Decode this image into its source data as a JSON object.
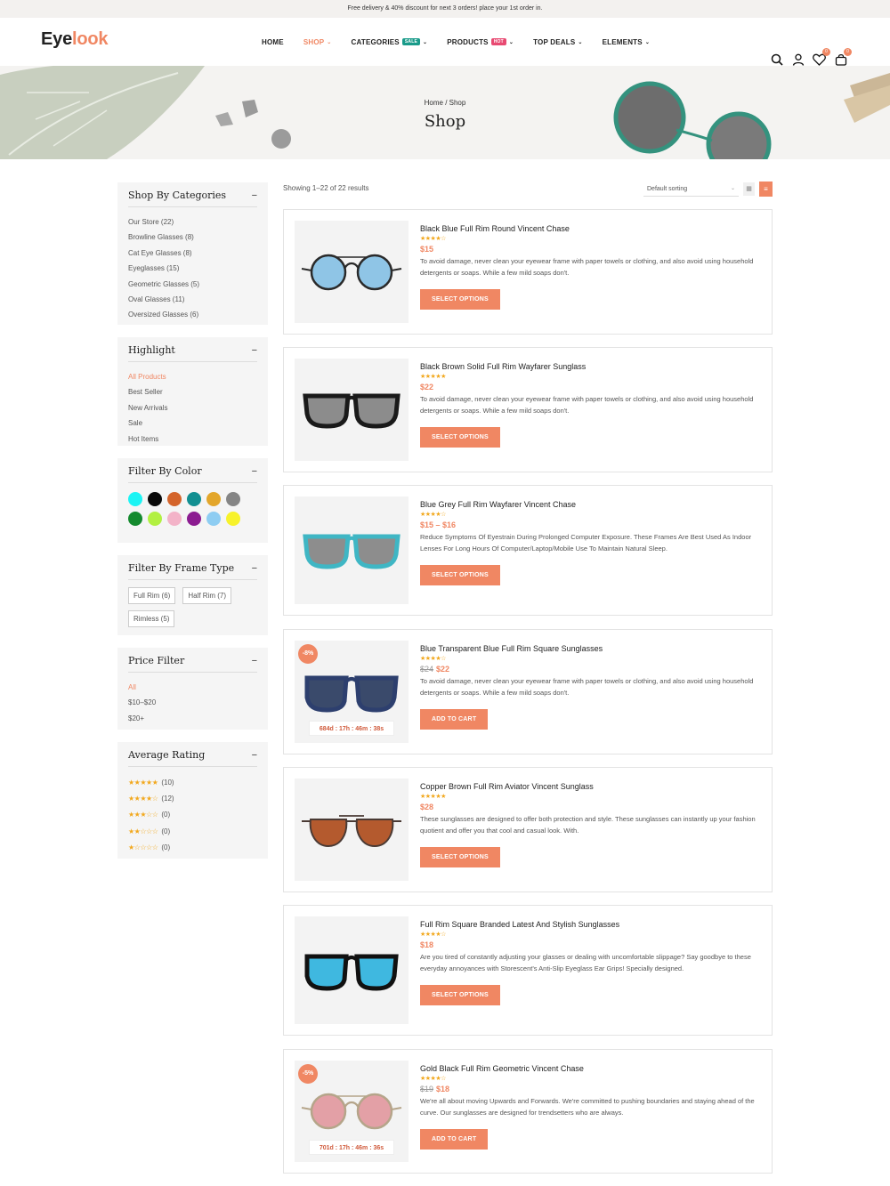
{
  "topbar": {
    "text": "Free delivery & 40% discount for next 3 orders! place your 1st order in."
  },
  "logo": {
    "part1": "Eye",
    "part2": "look"
  },
  "nav": [
    {
      "label": "HOME",
      "active": false,
      "dropdown": false,
      "tag": ""
    },
    {
      "label": "SHOP",
      "active": true,
      "dropdown": true,
      "tag": ""
    },
    {
      "label": "CATEGORIES",
      "active": false,
      "dropdown": true,
      "tag": "SALE"
    },
    {
      "label": "PRODUCTS",
      "active": false,
      "dropdown": true,
      "tag": "HOT"
    },
    {
      "label": "TOP DEALS",
      "active": false,
      "dropdown": true,
      "tag": ""
    },
    {
      "label": "ELEMENTS",
      "active": false,
      "dropdown": true,
      "tag": ""
    }
  ],
  "header_icons": {
    "wishlist_count": "0",
    "cart_count": "0"
  },
  "banner": {
    "breadcrumb": "Home / Shop",
    "title": "Shop"
  },
  "sidebar": {
    "categories": {
      "title": "Shop By Categories",
      "items": [
        "Our Store (22)",
        "Browline Glasses (8)",
        "Cat Eye Glasses (8)",
        "Eyeglasses (15)",
        "Geometric Glasses (5)",
        "Oval Glasses (11)",
        "Oversized Glasses (6)"
      ]
    },
    "highlight": {
      "title": "Highlight",
      "items": [
        "All Products",
        "Best Seller",
        "New Arrivals",
        "Sale",
        "Hot Items"
      ],
      "active_index": 0
    },
    "colors": {
      "title": "Filter By Color",
      "swatches": [
        "#1cf4f4",
        "#0a0a0a",
        "#d4642b",
        "#128f91",
        "#e3a62b",
        "#858585",
        "#148a2e",
        "#b2f041",
        "#f3b3c8",
        "#8c1c91",
        "#8ecdf2",
        "#f7f22b"
      ]
    },
    "frame_type": {
      "title": "Filter By Frame Type",
      "items": [
        "Full Rim (6)",
        "Half Rim (7)",
        "Rimless (5)"
      ]
    },
    "price": {
      "title": "Price Filter",
      "items": [
        "All",
        "$10–$20",
        "$20+"
      ],
      "active_index": 0
    },
    "rating": {
      "title": "Average Rating",
      "rows": [
        {
          "stars": 5,
          "count": "(10)"
        },
        {
          "stars": 4,
          "count": "(12)"
        },
        {
          "stars": 3,
          "count": "(0)"
        },
        {
          "stars": 2,
          "count": "(0)"
        },
        {
          "stars": 1,
          "count": "(0)"
        }
      ]
    }
  },
  "toolbar": {
    "results": "Showing 1–22 of 22 results",
    "sorting": "Default sorting"
  },
  "products": [
    {
      "name": "Black Blue Full Rim Round Vincent Chase",
      "stars": 4,
      "old_price": "",
      "price": "$15",
      "desc": "To avoid damage, never clean your eyewear frame with paper towels or clothing, and also avoid using household detergents or soaps. While a few mild soaps don't.",
      "button": "SELECT OPTIONS",
      "discount": "",
      "timer": "",
      "frame": "round",
      "lens": "#8fc5e6",
      "rim": "#2a2a2a"
    },
    {
      "name": "Black Brown Solid Full Rim Wayfarer Sunglass",
      "stars": 5,
      "old_price": "",
      "price": "$22",
      "desc": "To avoid damage, never clean your eyewear frame with paper towels or clothing, and also avoid using household detergents or soaps. While a few mild soaps don't.",
      "button": "SELECT OPTIONS",
      "discount": "",
      "timer": "",
      "frame": "wayfarer",
      "lens": "#8c8c8c",
      "rim": "#1a1a1a"
    },
    {
      "name": "Blue Grey Full Rim Wayfarer Vincent Chase",
      "stars": 4,
      "old_price": "",
      "price": "$15 – $16",
      "desc": "Reduce Symptoms Of Eyestrain During Prolonged Computer Exposure. These Frames Are Best Used As Indoor Lenses For Long Hours Of Computer/Laptop/Mobile Use To Maintain Natural Sleep.",
      "button": "SELECT OPTIONS",
      "discount": "",
      "timer": "",
      "frame": "wayfarer",
      "lens": "#8d8d8d",
      "rim": "#3fb6c4"
    },
    {
      "name": "Blue Transparent Blue Full Rim Square Sunglasses",
      "stars": 4,
      "old_price": "$24",
      "price": "$22",
      "desc": "To avoid damage, never clean your eyewear frame with paper towels or clothing, and also avoid using household detergents or soaps. While a few mild soaps don't.",
      "button": "ADD TO CART",
      "discount": "-8%",
      "timer": "684d : 17h : 46m : 38s",
      "frame": "square",
      "lens": "#3a4a6b",
      "rim": "#2d3f6e"
    },
    {
      "name": "Copper Brown Full Rim Aviator Vincent Sunglass",
      "stars": 5,
      "old_price": "",
      "price": "$28",
      "desc": "These sunglasses are designed to offer both protection and style. These sunglasses can instantly up your fashion quotient and offer you that cool and casual look. With.",
      "button": "SELECT OPTIONS",
      "discount": "",
      "timer": "",
      "frame": "aviator",
      "lens": "#b45a2e",
      "rim": "#4a3a34"
    },
    {
      "name": "Full Rim Square Branded Latest And Stylish Sunglasses",
      "stars": 4,
      "old_price": "",
      "price": "$18",
      "desc": "Are you tired of constantly adjusting your glasses or dealing with uncomfortable slippage? Say goodbye to these everyday annoyances with Storescent's Anti-Slip Eyeglass Ear Grips! Specially designed.",
      "button": "SELECT OPTIONS",
      "discount": "",
      "timer": "",
      "frame": "square",
      "lens": "#3fb8e0",
      "rim": "#111111"
    },
    {
      "name": "Gold Black Full Rim Geometric Vincent Chase",
      "stars": 4,
      "old_price": "$19",
      "price": "$18",
      "desc": "We're all about moving Upwards and Forwards. We're committed to pushing boundaries and staying ahead of the curve. Our sunglasses are designed for trendsetters who are always.",
      "button": "ADD TO CART",
      "discount": "-5%",
      "timer": "701d : 17h : 46m : 36s",
      "frame": "round",
      "lens": "#e3a0a6",
      "rim": "#b5a58a"
    }
  ]
}
